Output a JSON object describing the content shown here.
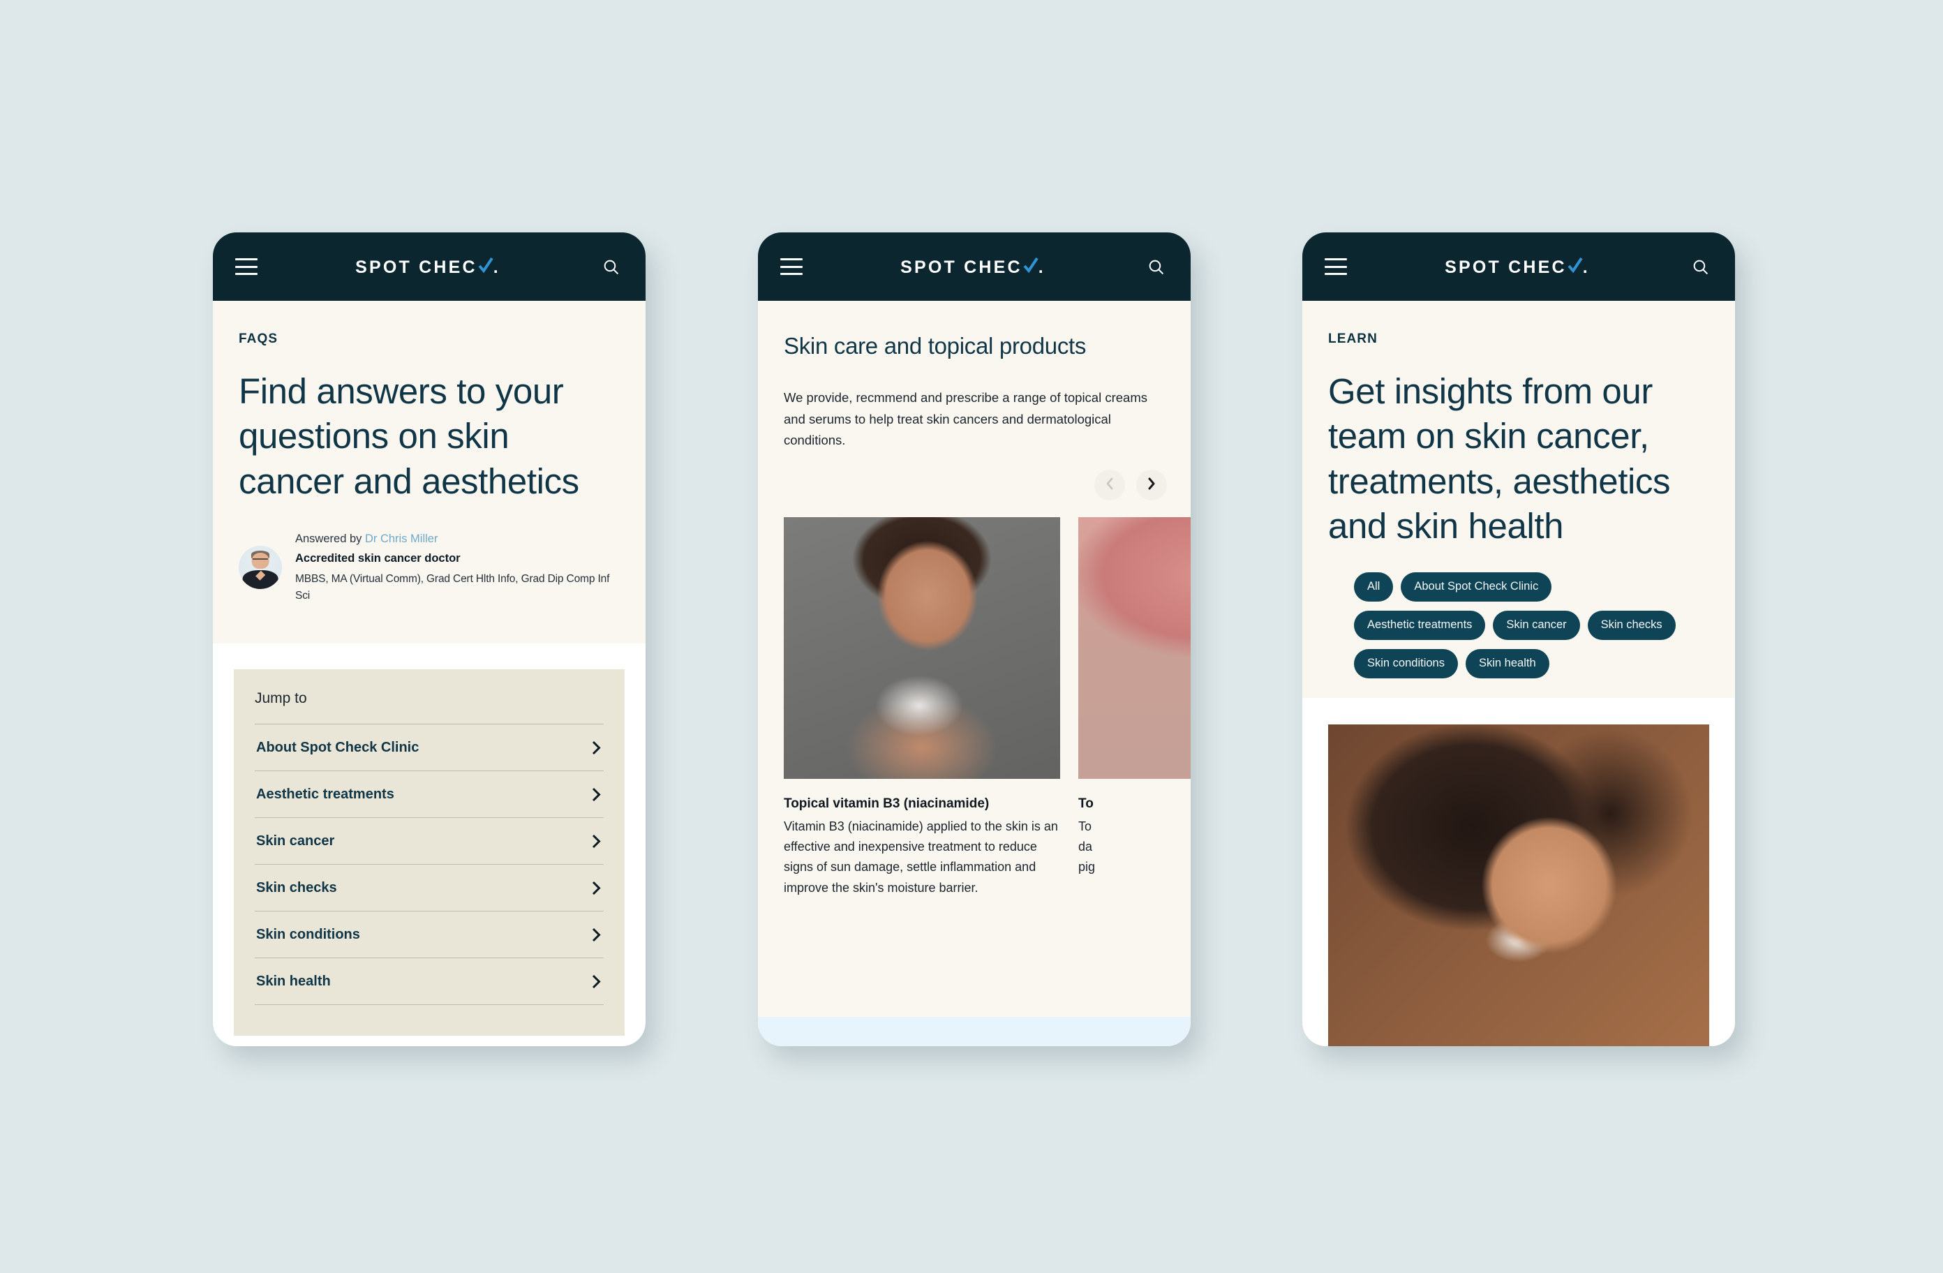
{
  "page": {
    "background_color": "#dee8ea",
    "brand_navy": "#0c2630",
    "brand_teal": "#0f4456",
    "brand_blue": "#2f93d4",
    "cream": "#faf7f1",
    "beige_card": "#e9e6d8",
    "light_blue": "#e7f4fb"
  },
  "header": {
    "menu_icon": "hamburger-icon",
    "search_icon": "search-icon",
    "logo_text": "SPOT CHEC",
    "logo_tick": "check-mark-icon",
    "logo_dot": "."
  },
  "phone1": {
    "eyebrow": "FAQS",
    "heading": "Find answers to your questions on skin cancer and aesthetics",
    "byline": {
      "answered_by_prefix": "Answered by ",
      "doctor_name": "Dr Chris Miller",
      "role": "Accredited skin cancer doctor",
      "qualifications": "MBBS, MA (Virtual Comm), Grad Cert Hlth Info, Grad Dip Comp Inf Sci",
      "avatar": "doctor-avatar"
    },
    "jump_to": {
      "title": "Jump to",
      "items": [
        {
          "label": "About Spot Check Clinic"
        },
        {
          "label": "Aesthetic treatments"
        },
        {
          "label": "Skin cancer"
        },
        {
          "label": "Skin checks"
        },
        {
          "label": "Skin conditions"
        },
        {
          "label": "Skin health"
        }
      ]
    }
  },
  "phone2": {
    "heading": "Skin care and topical products",
    "intro": "We provide, recmmend and prescribe a range of topical creams and serums to help treat skin cancers and dermatological conditions.",
    "carousel": {
      "prev_icon": "chevron-left-icon",
      "next_icon": "chevron-right-icon",
      "prev_disabled": true,
      "next_disabled": false
    },
    "cards": [
      {
        "image": "woman-holding-cream-jar-photo",
        "title": "Topical vitamin B3 (niacinamide)",
        "body": "Vitamin B3 (niacinamide) applied to the skin is an effective and inexpensive treatment to reduce signs of sun damage, settle inflammation and improve the skin's moisture barrier."
      },
      {
        "image": "skin-closeup-photo",
        "title": "To",
        "body_line1": "To",
        "body_line2": "da",
        "body_line3": "pig"
      }
    ]
  },
  "phone3": {
    "eyebrow": "LEARN",
    "heading": "Get insights from our team on skin cancer, treatments, aesthetics and skin health",
    "filters": [
      {
        "label": "All"
      },
      {
        "label": "About Spot Check Clinic"
      },
      {
        "label": "Aesthetic treatments"
      },
      {
        "label": "Skin cancer"
      },
      {
        "label": "Skin checks"
      },
      {
        "label": "Skin conditions"
      },
      {
        "label": "Skin health"
      }
    ],
    "photo": "woman-applying-sunscreen-photo"
  }
}
